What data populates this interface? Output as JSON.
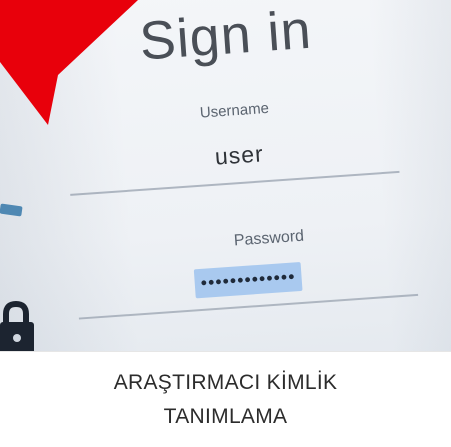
{
  "screen": {
    "title": "Sign in",
    "username_label": "Username",
    "username_value": "user",
    "password_label": "Password",
    "password_value": "•••••••••••••"
  },
  "caption": {
    "line1": "ARAŞTIRMACI KİMLİK",
    "line2": "TANIMLAMA"
  },
  "icons": {
    "lock": "lock-icon",
    "pointer": "arrow-pointer-icon"
  },
  "colors": {
    "arrow": "#e8000b",
    "password_highlight": "#a9c9ef",
    "caption_text": "#2c2c2c"
  }
}
